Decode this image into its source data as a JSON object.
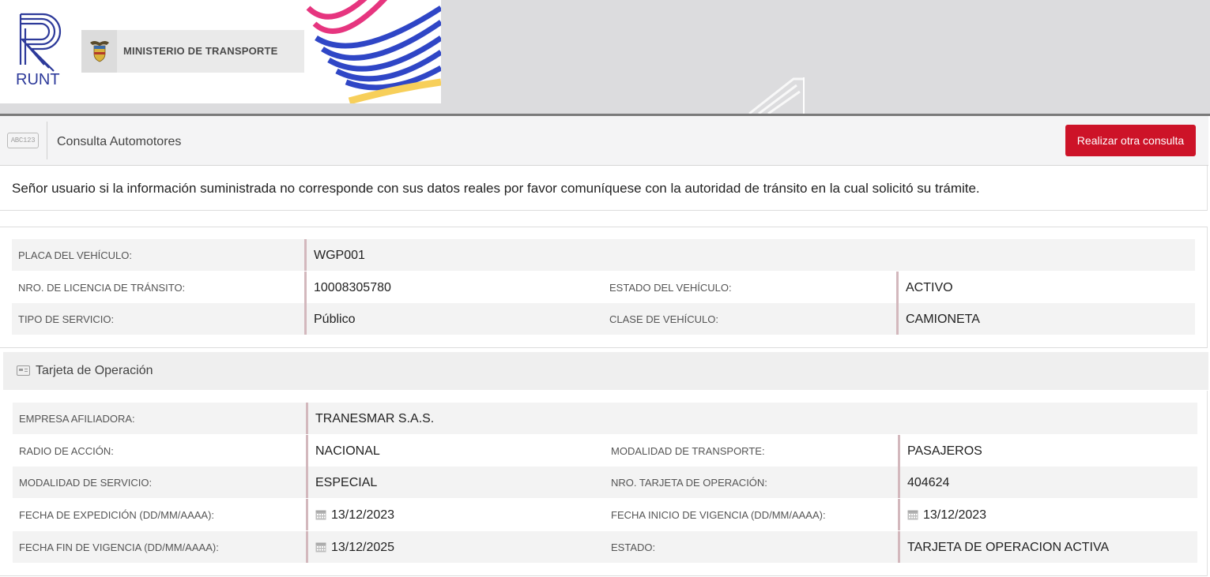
{
  "header": {
    "logo_text": "RUNT",
    "ministerio": "MINISTERIO DE TRANSPORTE"
  },
  "toolbar": {
    "icon_text": "ABC123",
    "title": "Consulta Automotores",
    "button_label": "Realizar otra consulta"
  },
  "notice": "Señor usuario si la información suministrada no corresponde con sus datos reales por favor comuníquese con la autoridad de tránsito en la cual solicitó su trámite.",
  "vehicle": {
    "placa_label": "PLACA DEL VEHÍCULO:",
    "placa_value": "WGP001",
    "licencia_label": "NRO. DE LICENCIA DE TRÁNSITO:",
    "licencia_value": "10008305780",
    "estado_label": "ESTADO DEL VEHÍCULO:",
    "estado_value": "ACTIVO",
    "servicio_label": "TIPO DE SERVICIO:",
    "servicio_value": "Público",
    "clase_label": "CLASE DE VEHÍCULO:",
    "clase_value": "CAMIONETA"
  },
  "tarjeta": {
    "section_title": "Tarjeta de Operación",
    "empresa_label": "EMPRESA AFILIADORA:",
    "empresa_value": "TRANESMAR S.A.S.",
    "radio_label": "RADIO DE ACCIÓN:",
    "radio_value": "NACIONAL",
    "modalidad_transporte_label": "MODALIDAD DE TRANSPORTE:",
    "modalidad_transporte_value": "PASAJEROS",
    "modalidad_servicio_label": "MODALIDAD DE SERVICIO:",
    "modalidad_servicio_value": "ESPECIAL",
    "nro_tarjeta_label": "NRO. TARJETA DE OPERACIÓN:",
    "nro_tarjeta_value": "404624",
    "fecha_expedicion_label": "FECHA DE EXPEDICIÓN (DD/MM/AAAA):",
    "fecha_expedicion_value": "13/12/2023",
    "fecha_inicio_label": "FECHA INICIO DE VIGENCIA (DD/MM/AAAA):",
    "fecha_inicio_value": "13/12/2023",
    "fecha_fin_label": "FECHA FIN DE VIGENCIA (DD/MM/AAAA):",
    "fecha_fin_value": "13/12/2025",
    "estado_label": "ESTADO:",
    "estado_value": "TARJETA DE OPERACION ACTIVA"
  },
  "colors": {
    "brand_blue": "#2d3a9a",
    "button_red": "#cd1328",
    "value_border": "#d3b8bd"
  },
  "icons": {
    "calendar": "calendar-icon",
    "card": "card-icon",
    "plate": "license-plate-icon"
  }
}
